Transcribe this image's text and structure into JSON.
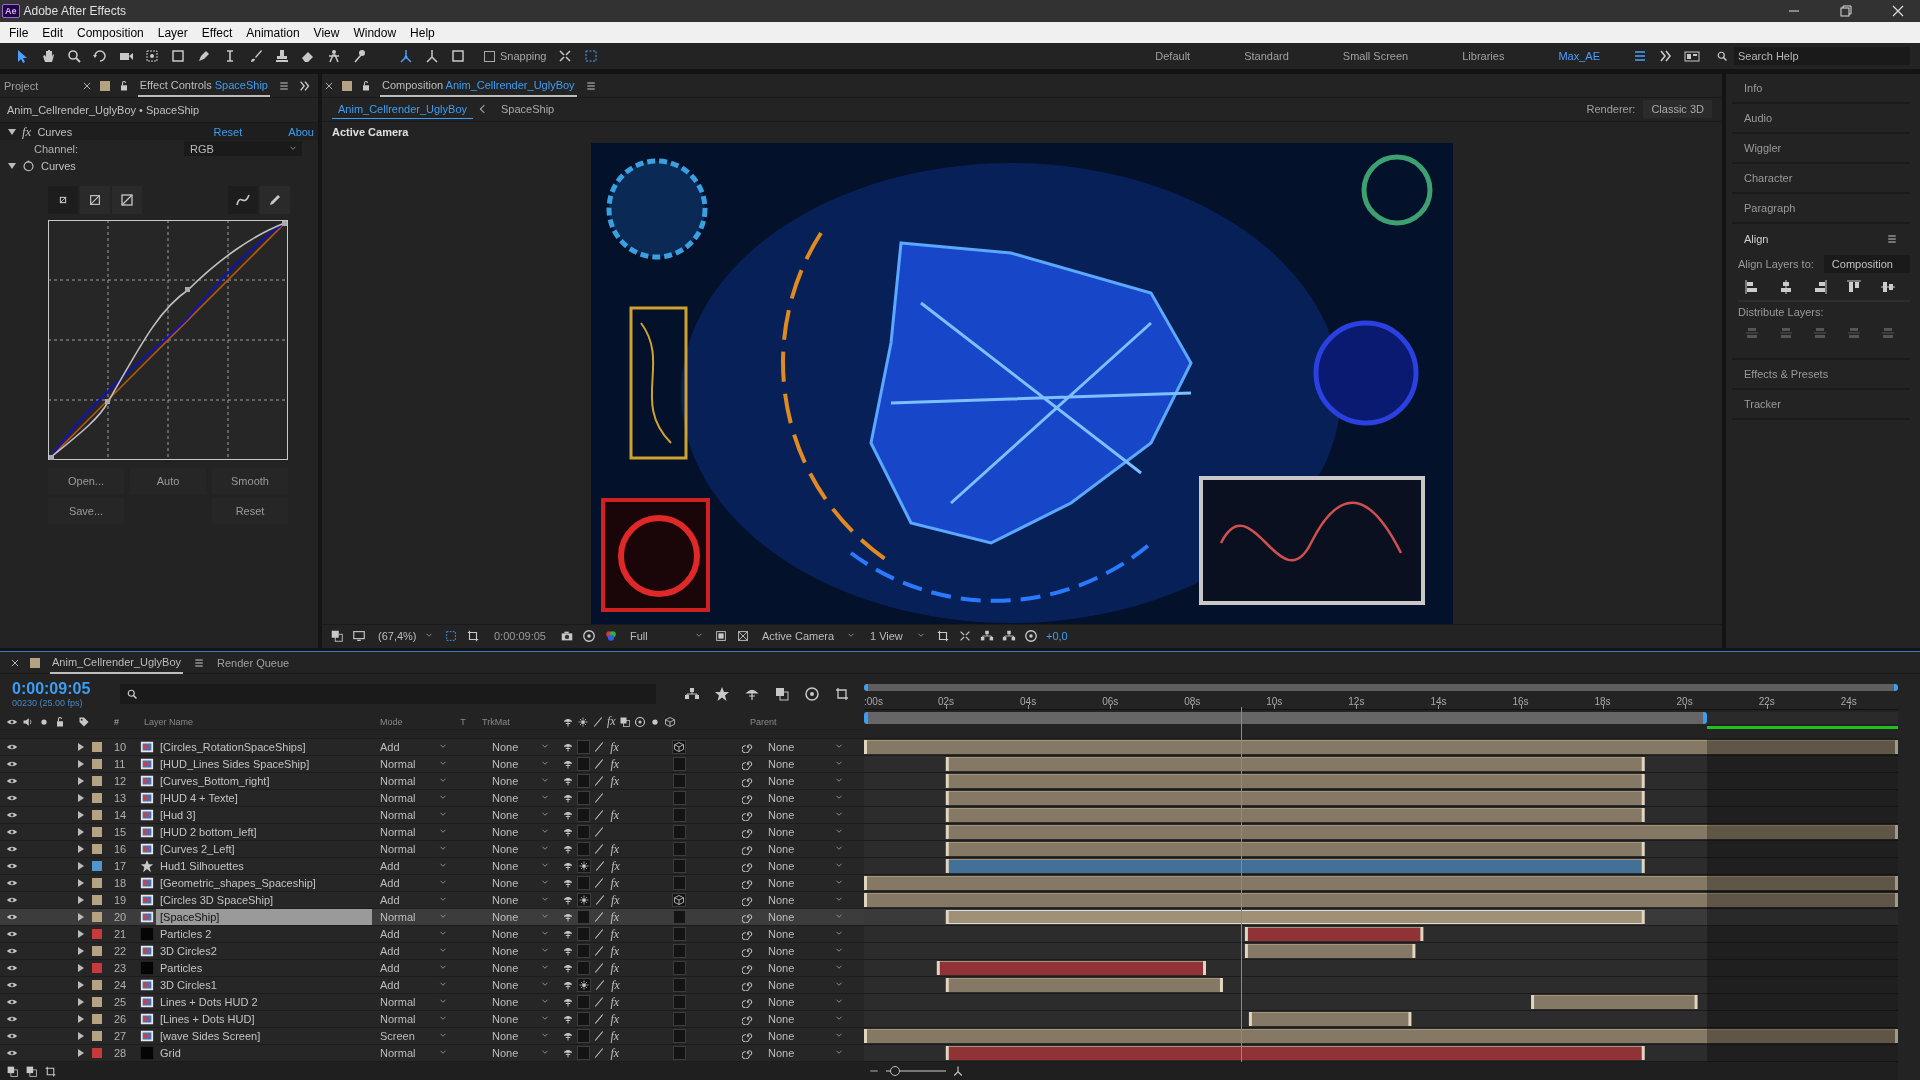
{
  "window": {
    "logo": "Ae",
    "title": "Adobe After Effects"
  },
  "menu": [
    "File",
    "Edit",
    "Composition",
    "Layer",
    "Effect",
    "Animation",
    "View",
    "Window",
    "Help"
  ],
  "toolbar": {
    "snapping": {
      "label": "Snapping",
      "checked": false
    }
  },
  "workspaces": [
    {
      "label": "Default",
      "selected": false
    },
    {
      "label": "Standard",
      "selected": false
    },
    {
      "label": "Small Screen",
      "selected": false
    },
    {
      "label": "Libraries",
      "selected": false
    },
    {
      "label": "Max_AE",
      "selected": true
    }
  ],
  "search_help": {
    "placeholder": "Search Help"
  },
  "effect_controls": {
    "project_tab": "Project",
    "tab_label": "Effect Controls",
    "tab_target": "SpaceShip",
    "subtitle": "Anim_Cellrender_UglyBoy • SpaceShip",
    "effect": {
      "fx": "fx",
      "name": "Curves",
      "expanded": true,
      "reset": "Reset",
      "about": "Abou"
    },
    "channel": {
      "label": "Channel:",
      "value": "RGB"
    },
    "curves": {
      "label": "Curves",
      "expanded": true
    },
    "buttons_top": [
      "Open...",
      "Auto",
      "Smooth"
    ],
    "buttons_bottom": [
      "Save...",
      "Reset"
    ]
  },
  "composition": {
    "tab_label": "Composition",
    "tab_target": "Anim_Cellrender_UglyBoy",
    "breadcrumbs": [
      {
        "label": "Anim_Cellrender_UglyBoy",
        "selected": true
      },
      {
        "label": "SpaceShip",
        "selected": false
      }
    ],
    "renderer": {
      "label": "Renderer:",
      "value": "Classic 3D"
    },
    "view_label": "Active Camera",
    "viewer_bar": {
      "zoom": "(67,4%)",
      "timecode": "0:00:09:05",
      "resolution": "Full",
      "camera": "Active Camera",
      "views": "1 View",
      "exposure": "+0,0"
    }
  },
  "panels": [
    {
      "label": "Info",
      "expanded": false
    },
    {
      "label": "Audio",
      "expanded": false
    },
    {
      "label": "Wiggler",
      "expanded": false
    },
    {
      "label": "Character",
      "expanded": false
    },
    {
      "label": "Paragraph",
      "expanded": false
    },
    {
      "label": "Align",
      "expanded": true
    },
    {
      "label": "Effects & Presets",
      "expanded": false
    },
    {
      "label": "Tracker",
      "expanded": false
    }
  ],
  "align": {
    "layers_to_label": "Align Layers to:",
    "layers_to": "Composition",
    "distribute_label": "Distribute Layers:"
  },
  "timeline": {
    "tabs": [
      {
        "label": "Anim_Cellrender_UglyBoy",
        "selected": true
      },
      {
        "label": "Render Queue",
        "selected": false
      }
    ],
    "timecode": "0:00:09:05",
    "frame_info": "00230 (25.00 fps)",
    "columns": {
      "number": "#",
      "name": "Layer Name",
      "mode": "Mode",
      "t": "T",
      "trkmat": "TrkMat",
      "fx": "fx",
      "parent": "Parent"
    },
    "ruler": [
      ":00s",
      "02s",
      "04s",
      "06s",
      "08s",
      "10s",
      "12s",
      "14s",
      "16s",
      "18s",
      "20s",
      "22s",
      "24s"
    ],
    "playhead": {
      "level": 0.365
    },
    "work_area": {
      "level": 0.815
    },
    "zoom_slider": {
      "level": 0.15
    },
    "layers": [
      {
        "number": "10",
        "name": "[Circles_RotationSpaceShips]",
        "kind": "comp",
        "color": "#b5a282",
        "mode": "Add",
        "trkmat": "None",
        "parent": "None",
        "fx": "fx",
        "collapse": false,
        "three_d": true,
        "selected": false,
        "in_point": {
          "level": 0
        },
        "out_point": {
          "level": 1
        }
      },
      {
        "number": "11",
        "name": "[HUD_Lines Sides SpaceShip]",
        "kind": "comp",
        "color": "#b5a282",
        "mode": "Normal",
        "trkmat": "None",
        "parent": "None",
        "fx": "fx",
        "collapse": false,
        "three_d": false,
        "selected": false,
        "in_point": {
          "level": 0.079
        },
        "out_point": {
          "level": 0.754
        }
      },
      {
        "number": "12",
        "name": "[Curves_Bottom_right]",
        "kind": "comp",
        "color": "#b5a282",
        "mode": "Normal",
        "trkmat": "None",
        "parent": "None",
        "fx": "fx",
        "collapse": false,
        "three_d": false,
        "selected": false,
        "in_point": {
          "level": 0.079
        },
        "out_point": {
          "level": 0.754
        }
      },
      {
        "number": "13",
        "name": "[HUD 4 + Texte]",
        "kind": "comp",
        "color": "#b5a282",
        "mode": "Normal",
        "trkmat": "None",
        "parent": "None",
        "collapse": false,
        "three_d": false,
        "selected": false,
        "in_point": {
          "level": 0.079
        },
        "out_point": {
          "level": 0.754
        }
      },
      {
        "number": "14",
        "name": "[Hud 3]",
        "kind": "comp",
        "color": "#b5a282",
        "mode": "Normal",
        "trkmat": "None",
        "parent": "None",
        "fx": "fx",
        "collapse": false,
        "three_d": false,
        "selected": false,
        "in_point": {
          "level": 0.079
        },
        "out_point": {
          "level": 0.754
        }
      },
      {
        "number": "15",
        "name": "[HUD 2 bottom_left]",
        "kind": "comp",
        "color": "#b5a282",
        "mode": "Normal",
        "trkmat": "None",
        "parent": "None",
        "collapse": false,
        "three_d": false,
        "selected": false,
        "in_point": {
          "level": 0.079
        },
        "out_point": {
          "level": 1
        }
      },
      {
        "number": "16",
        "name": "[Curves 2_Left]",
        "kind": "comp",
        "color": "#b5a282",
        "mode": "Normal",
        "trkmat": "None",
        "parent": "None",
        "fx": "fx",
        "collapse": false,
        "three_d": false,
        "selected": false,
        "in_point": {
          "level": 0.079
        },
        "out_point": {
          "level": 0.754
        }
      },
      {
        "number": "17",
        "name": "Hud1 Silhouettes",
        "kind": "shape",
        "color": "#4f95d0",
        "mode": "Add",
        "trkmat": "None",
        "parent": "None",
        "fx": "fx",
        "collapse": true,
        "three_d": false,
        "selected": false,
        "in_point": {
          "level": 0.079
        },
        "out_point": {
          "level": 0.754
        }
      },
      {
        "number": "18",
        "name": "[Geometric_shapes_Spaceship]",
        "kind": "comp",
        "color": "#b5a282",
        "mode": "Add",
        "trkmat": "None",
        "parent": "None",
        "fx": "fx",
        "collapse": false,
        "three_d": false,
        "selected": false,
        "in_point": {
          "level": 0
        },
        "out_point": {
          "level": 1
        }
      },
      {
        "number": "19",
        "name": "[Circles 3D SpaceShip]",
        "kind": "comp",
        "color": "#b5a282",
        "mode": "Add",
        "trkmat": "None",
        "parent": "None",
        "fx": "fx",
        "collapse": true,
        "three_d": true,
        "selected": false,
        "in_point": {
          "level": 0
        },
        "out_point": {
          "level": 1
        }
      },
      {
        "number": "20",
        "name": "[SpaceShip]",
        "kind": "comp",
        "color": "#b5a282",
        "mode": "Normal",
        "trkmat": "None",
        "parent": "None",
        "fx": "fx",
        "collapse": false,
        "three_d": false,
        "selected": true,
        "in_point": {
          "level": 0.079
        },
        "out_point": {
          "level": 0.754
        }
      },
      {
        "number": "21",
        "name": "Particles 2",
        "kind": "solid",
        "color": "#c8383c",
        "mode": "Add",
        "trkmat": "None",
        "parent": "None",
        "fx": "fx",
        "collapse": false,
        "three_d": false,
        "selected": false,
        "in_point": {
          "level": 0.369
        },
        "out_point": {
          "level": 0.54
        }
      },
      {
        "number": "22",
        "name": "3D Circles2",
        "kind": "comp",
        "color": "#b5a282",
        "mode": "Add",
        "trkmat": "None",
        "parent": "None",
        "fx": "fx",
        "collapse": false,
        "three_d": false,
        "selected": false,
        "in_point": {
          "level": 0.369
        },
        "out_point": {
          "level": 0.532
        }
      },
      {
        "number": "23",
        "name": "Particles",
        "kind": "solid",
        "color": "#c8383c",
        "mode": "Add",
        "trkmat": "None",
        "parent": "None",
        "fx": "fx",
        "collapse": false,
        "three_d": false,
        "selected": false,
        "in_point": {
          "level": 0.071
        },
        "out_point": {
          "level": 0.329
        }
      },
      {
        "number": "24",
        "name": "3D Circles1",
        "kind": "comp",
        "color": "#b5a282",
        "mode": "Add",
        "trkmat": "None",
        "parent": "None",
        "fx": "fx",
        "collapse": true,
        "three_d": false,
        "selected": false,
        "in_point": {
          "level": 0.079
        },
        "out_point": {
          "level": 0.345
        }
      },
      {
        "number": "25",
        "name": "Lines + Dots HUD 2",
        "kind": "comp",
        "color": "#b5a282",
        "mode": "Normal",
        "trkmat": "None",
        "parent": "None",
        "fx": "fx",
        "collapse": false,
        "three_d": false,
        "selected": false,
        "in_point": {
          "level": 0.647
        },
        "out_point": {
          "level": 0.806
        }
      },
      {
        "number": "26",
        "name": "[Lines + Dots HUD]",
        "kind": "comp",
        "color": "#b5a282",
        "mode": "Normal",
        "trkmat": "None",
        "parent": "None",
        "fx": "fx",
        "collapse": false,
        "three_d": false,
        "selected": false,
        "in_point": {
          "level": 0.373
        },
        "out_point": {
          "level": 0.528
        }
      },
      {
        "number": "27",
        "name": "[wave Sides Screen]",
        "kind": "comp",
        "color": "#b5a282",
        "mode": "Screen",
        "trkmat": "None",
        "parent": "None",
        "fx": "fx",
        "collapse": false,
        "three_d": false,
        "selected": false,
        "in_point": {
          "level": 0
        },
        "out_point": {
          "level": 1
        }
      },
      {
        "number": "28",
        "name": "Grid",
        "kind": "solid",
        "color": "#c8383c",
        "mode": "Normal",
        "trkmat": "None",
        "parent": "None",
        "fx": "fx",
        "collapse": false,
        "three_d": false,
        "selected": false,
        "in_point": {
          "level": 0.079
        },
        "out_point": {
          "level": 0.754
        }
      }
    ]
  }
}
